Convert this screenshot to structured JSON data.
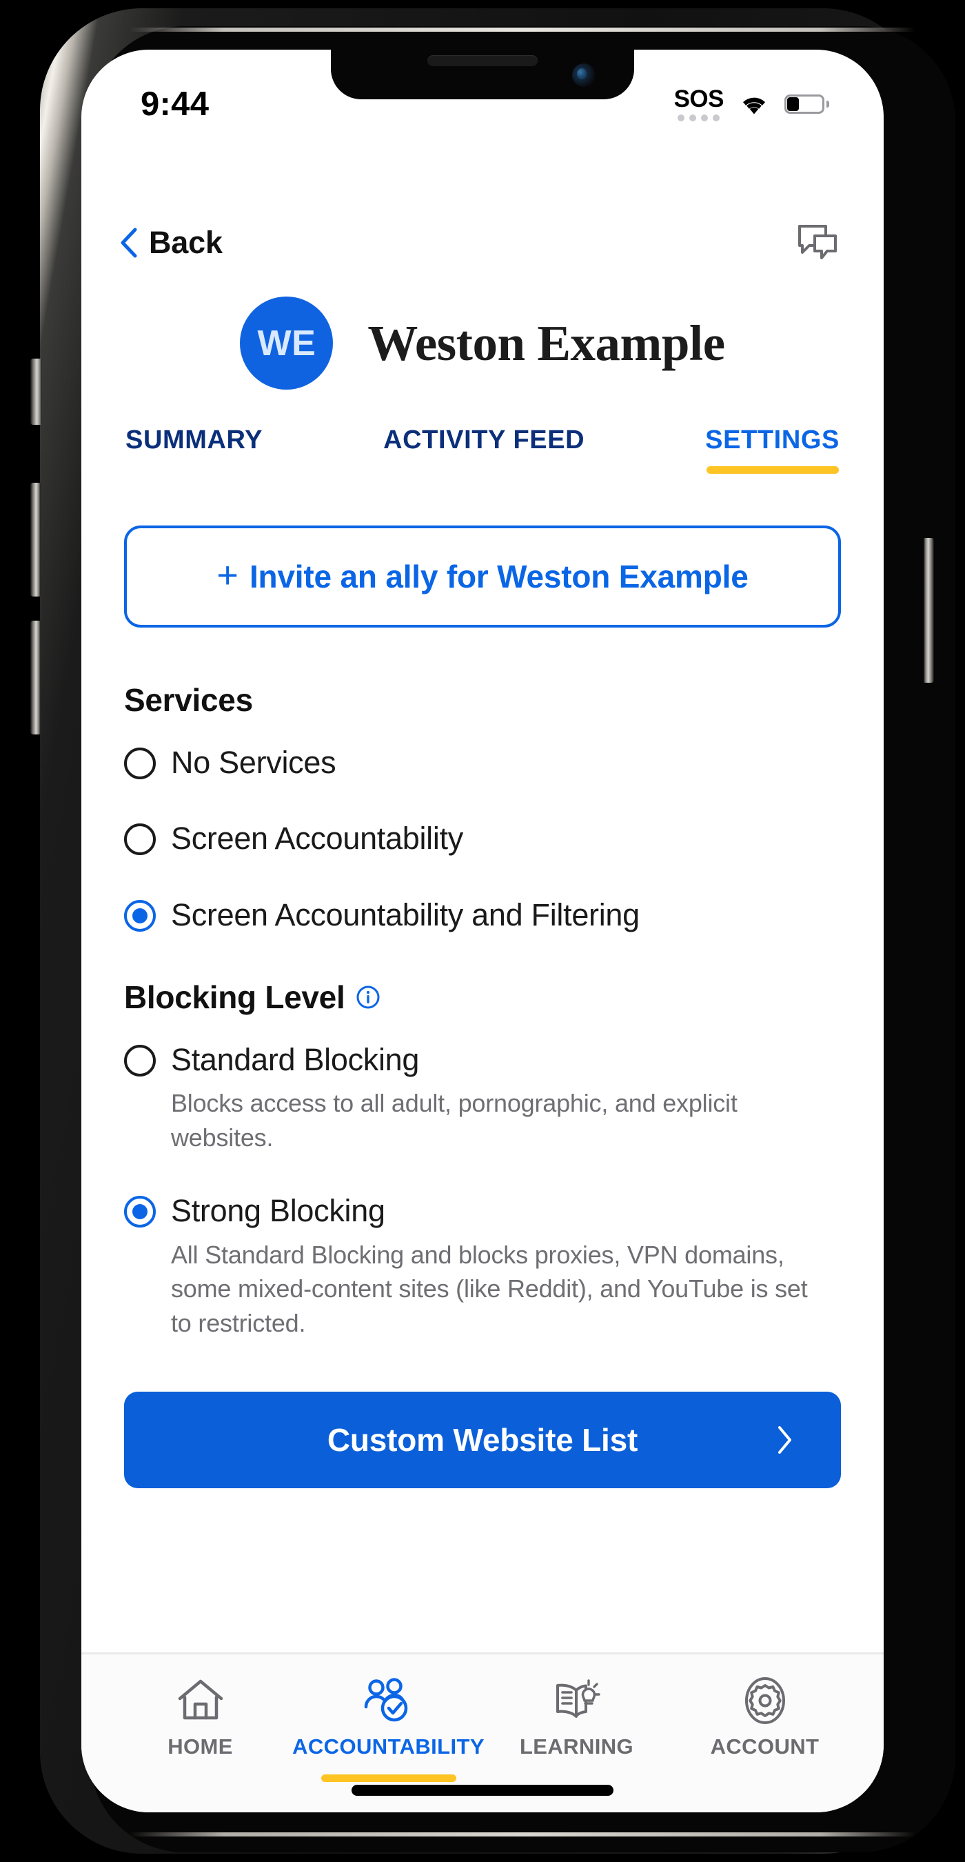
{
  "status_bar": {
    "time": "9:44",
    "sos_label": "SOS",
    "signal_dots": 4,
    "wifi_icon": "wifi-icon",
    "battery_icon": "battery-low-icon"
  },
  "navbar": {
    "back_label": "Back",
    "back_icon": "chevron-left-icon",
    "chat_icon": "chat-bubbles-icon"
  },
  "profile": {
    "initials": "WE",
    "name": "Weston Example"
  },
  "tabs": [
    {
      "label": "SUMMARY",
      "active": false
    },
    {
      "label": "ACTIVITY FEED",
      "active": false
    },
    {
      "label": "SETTINGS",
      "active": true
    }
  ],
  "invite": {
    "plus_icon": "plus-icon",
    "label": "Invite an ally for Weston Example"
  },
  "services": {
    "title": "Services",
    "options": [
      {
        "label": "No Services",
        "selected": false
      },
      {
        "label": "Screen Accountability",
        "selected": false
      },
      {
        "label": "Screen Accountability and Filtering",
        "selected": true
      }
    ]
  },
  "blocking_level": {
    "title": "Blocking Level",
    "info_icon": "info-circle-icon",
    "options": [
      {
        "label": "Standard Blocking",
        "selected": false,
        "description": "Blocks access to all adult, pornographic, and explicit websites."
      },
      {
        "label": "Strong Blocking",
        "selected": true,
        "description": "All Standard Blocking and blocks proxies, VPN domains, some mixed-content sites (like Reddit), and YouTube is set to restricted."
      }
    ]
  },
  "custom_website_list": {
    "label": "Custom Website List",
    "chevron_icon": "chevron-right-icon"
  },
  "bottom_nav": [
    {
      "label": "HOME",
      "icon": "home-icon",
      "active": false
    },
    {
      "label": "ACCOUNTABILITY",
      "icon": "people-check-icon",
      "active": true
    },
    {
      "label": "LEARNING",
      "icon": "book-lightbulb-icon",
      "active": false
    },
    {
      "label": "ACCOUNT",
      "icon": "gear-icon",
      "active": false
    }
  ],
  "colors": {
    "accent_blue": "#0b66e6",
    "button_blue": "#0b5fd8",
    "tab_navy": "#0b2f7a",
    "highlight_yellow": "#fec424",
    "muted_gray": "#6e6e73"
  }
}
